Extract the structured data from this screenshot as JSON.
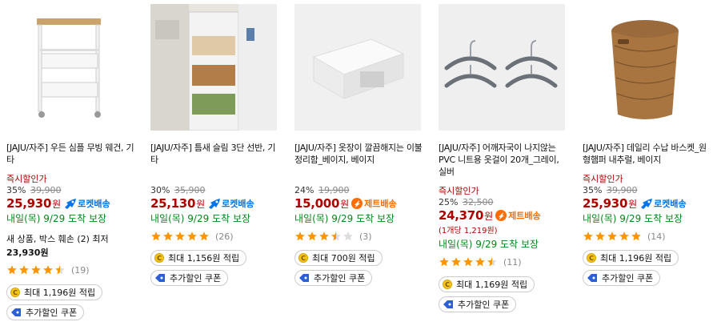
{
  "products": [
    {
      "title": "[JAJU/자주] 우든 심플 무빙 웨건, 기타",
      "instant_label": "즉시할인가",
      "discount": "35%",
      "original_price": "39,900",
      "price": "25,930",
      "won": "원",
      "badge": "로켓배송",
      "delivery": "내일(목) 9/29 도착 보장",
      "extra_line1": "새 상품, 박스 훼손 (2) 최저",
      "extra_line2": "23,930원",
      "rating": 4.5,
      "review_count": "(19)",
      "reward": "최대 1,196원 적립",
      "coupon": "추가할인 쿠폰"
    },
    {
      "title": "[JAJU/자주] 틈새 슬림 3단 선반, 기타",
      "discount": "30%",
      "original_price": "35,900",
      "price": "25,130",
      "won": "원",
      "badge": "로켓배송",
      "delivery": "내일(목) 9/29 도착 보장",
      "rating": 5,
      "review_count": "(26)",
      "reward": "최대 1,156원 적립",
      "coupon": "추가할인 쿠폰"
    },
    {
      "title": "[JAJU/자주] 옷장이 깔끔해지는 이불 정리함_베이지, 베이지",
      "discount": "24%",
      "original_price": "19,900",
      "price": "15,000",
      "won": "원",
      "badge": "제트배송",
      "delivery": "내일(목) 9/29 도착 보장",
      "rating": 3.5,
      "review_count": "(3)",
      "reward": "최대 700원 적립",
      "coupon": "추가할인 쿠폰"
    },
    {
      "title": "[JAJU/자주] 어깨자국이 나지않는 PVC 니트용 옷걸이 20개_그레이, 실버",
      "instant_label": "즉시할인가",
      "discount": "25%",
      "original_price": "32,500",
      "price": "24,370",
      "won": "원",
      "badge": "제트배송",
      "unit_price": "(1개당 1,219원)",
      "delivery": "내일(목) 9/29 도착 보장",
      "rating": 4.5,
      "review_count": "(11)",
      "reward": "최대 1,169원 적립",
      "coupon": "추가할인 쿠폰"
    },
    {
      "title": "[JAJU/자주] 데일리 수납 바스켓_원형햄퍼 내추럴, 베이지",
      "instant_label": "즉시할인가",
      "discount": "35%",
      "original_price": "39,900",
      "price": "25,930",
      "won": "원",
      "badge": "로켓배송",
      "delivery": "내일(목) 9/29 도착 보장",
      "rating": 5,
      "review_count": "(14)",
      "reward": "최대 1,196원 적립",
      "coupon": "추가할인 쿠폰"
    }
  ],
  "colors": {
    "price": "#ae0000",
    "rocket": "#0073e9",
    "jet": "#ff6d00",
    "delivery": "#00891a",
    "star": "#ff9600"
  },
  "icons": {
    "rocket_badge": "rocket-icon",
    "jet_badge": "jet-icon",
    "coin": "cash-coin-icon",
    "coupon": "coupon-tag-icon",
    "star": "star-icon"
  }
}
